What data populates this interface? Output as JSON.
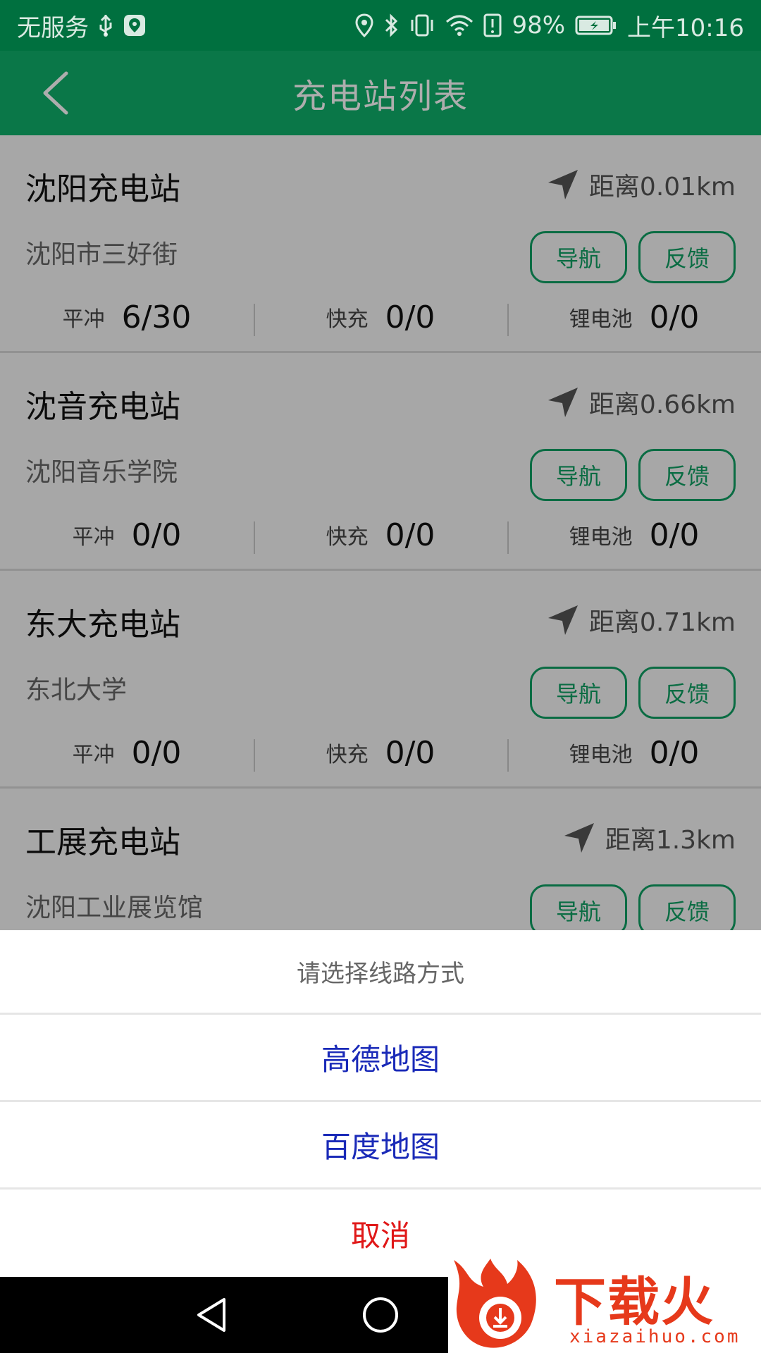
{
  "status_bar": {
    "carrier": "无服务",
    "battery_percent": "98%",
    "time": "上午10:16",
    "icons": [
      "usb-icon",
      "shield-icon",
      "location-icon",
      "bluetooth-icon",
      "vibrate-icon",
      "wifi-icon",
      "alert-icon",
      "battery-icon"
    ]
  },
  "app_bar": {
    "title": "充电站列表",
    "back_icon": "back-arrow-icon",
    "color": "#10b06a"
  },
  "stations": [
    {
      "name": "沈阳充电站",
      "distance": "距离0.01km",
      "address": "沈阳市三好街",
      "nav_label": "导航",
      "feedback_label": "反馈",
      "stats": [
        {
          "label": "平冲",
          "value": "6/30"
        },
        {
          "label": "快充",
          "value": "0/0"
        },
        {
          "label": "锂电池",
          "value": "0/0"
        }
      ]
    },
    {
      "name": "沈音充电站",
      "distance": "距离0.66km",
      "address": "沈阳音乐学院",
      "nav_label": "导航",
      "feedback_label": "反馈",
      "stats": [
        {
          "label": "平冲",
          "value": "0/0"
        },
        {
          "label": "快充",
          "value": "0/0"
        },
        {
          "label": "锂电池",
          "value": "0/0"
        }
      ]
    },
    {
      "name": "东大充电站",
      "distance": "距离0.71km",
      "address": "东北大学",
      "nav_label": "导航",
      "feedback_label": "反馈",
      "stats": [
        {
          "label": "平冲",
          "value": "0/0"
        },
        {
          "label": "快充",
          "value": "0/0"
        },
        {
          "label": "锂电池",
          "value": "0/0"
        }
      ]
    },
    {
      "name": "工展充电站",
      "distance": "距离1.3km",
      "address": "沈阳工业展览馆",
      "nav_label": "导航",
      "feedback_label": "反馈"
    }
  ],
  "sheet": {
    "title": "请选择线路方式",
    "options": [
      "高德地图",
      "百度地图"
    ],
    "cancel": "取消"
  },
  "watermark": {
    "text": "下载火",
    "sub": "xiazaihuo.com"
  },
  "colors": {
    "accent": "#10a064",
    "option_blue": "#1a2ab8",
    "cancel_red": "#e01818"
  }
}
